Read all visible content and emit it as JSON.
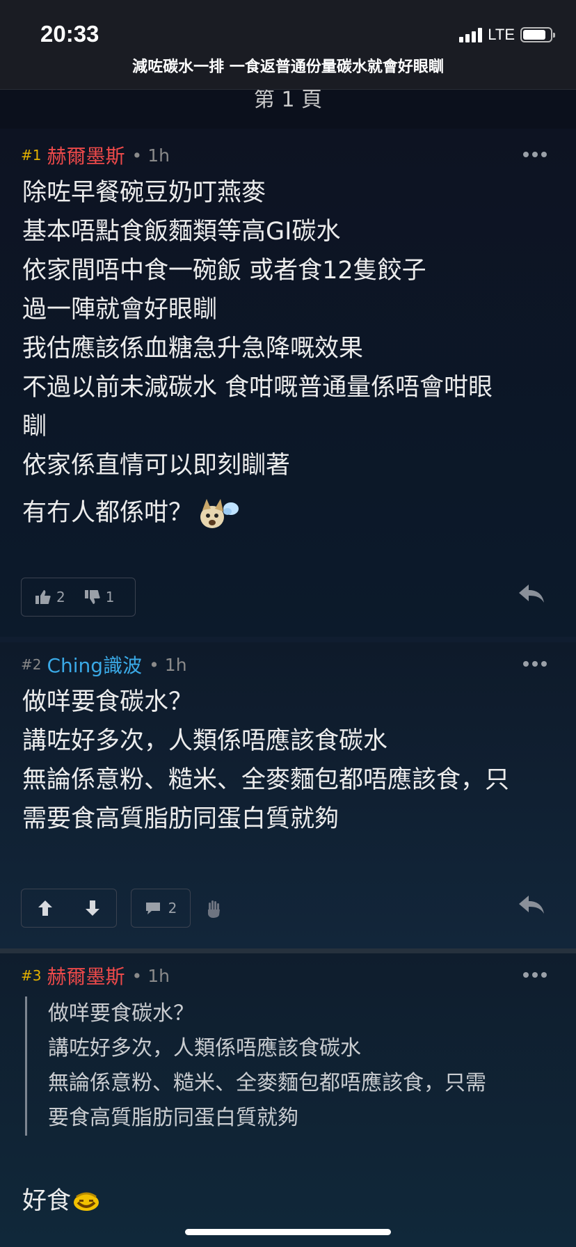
{
  "status_bar": {
    "time": "20:33",
    "network": "LTE"
  },
  "thread": {
    "title": "減咗碳水一排 一食返普通份量碳水就會好眼瞓",
    "page_label": "第 1 頁"
  },
  "posts": [
    {
      "number": "#1",
      "username": "赫爾墨斯",
      "time": "• 1h",
      "lines": [
        "除咗早餐碗豆奶叮燕麥",
        "基本唔點食飯麵類等高GI碳水",
        "依家間唔中食一碗飯 或者食12隻餃子",
        "過一陣就會好眼瞓",
        "我估應該係血糖急升急降嘅效果",
        "不過以前未減碳水 食咁嘅普通量係唔會咁眼",
        "瞓",
        "依家係直情可以即刻瞓著",
        "有冇人都係咁？"
      ],
      "likes": "2",
      "dislikes": "1"
    },
    {
      "number": "#2",
      "username": "Ching識波",
      "time": "• 1h",
      "lines": [
        "做咩要食碳水？",
        "講咗好多次，人類係唔應該食碳水",
        "無論係意粉、糙米、全麥麵包都唔應該食，只",
        "需要食高質脂肪同蛋白質就夠"
      ],
      "comment_count": "2"
    },
    {
      "number": "#3",
      "username": "赫爾墨斯",
      "time": "• 1h",
      "quote_lines": [
        "做咩要食碳水？",
        "講咗好多次，人類係唔應該食碳水",
        "無論係意粉、糙米、全麥麵包都唔應該食，只需",
        "要食高質脂肪同蛋白質就夠"
      ],
      "reply": "好食"
    }
  ],
  "colors": {
    "op_username": "#ee4a4a",
    "user2_username": "#3aa9e6",
    "op_number": "#e4b100"
  }
}
